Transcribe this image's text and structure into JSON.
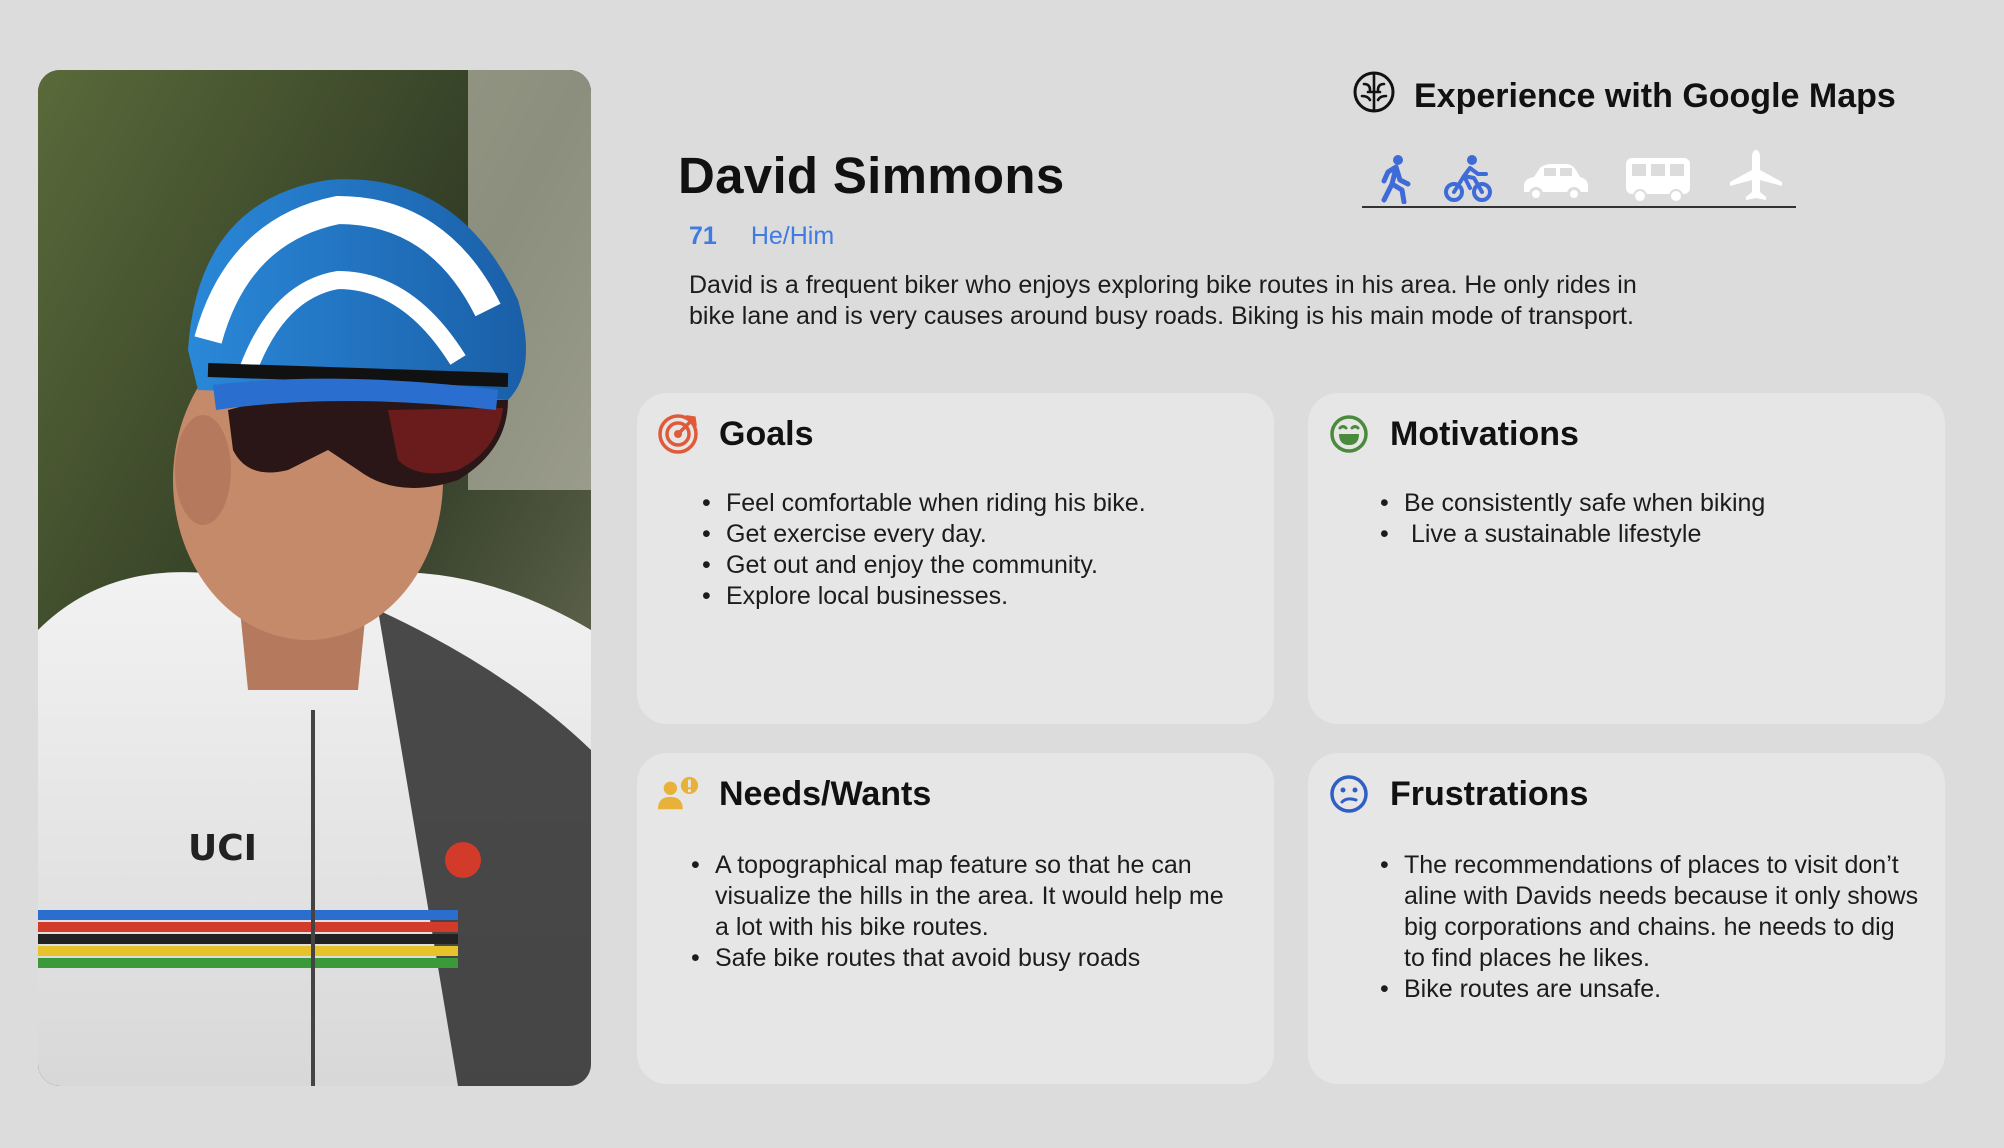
{
  "profile": {
    "name": "David Simmons",
    "age": "71",
    "pronouns": "He/Him",
    "bio": "David is a frequent biker who enjoys exploring bike routes in his area. He only rides in bike lane and is very causes around busy roads. Biking is his main mode of transport."
  },
  "experience": {
    "title": "Experience with Google Maps",
    "icon": "brain-icon",
    "modes": [
      {
        "name": "walk-icon",
        "color": "#3f6bd8"
      },
      {
        "name": "bike-icon",
        "color": "#3f6bd8"
      },
      {
        "name": "car-icon",
        "color": "#ffffff"
      },
      {
        "name": "bus-icon",
        "color": "#ffffff"
      },
      {
        "name": "plane-icon",
        "color": "#ffffff"
      }
    ]
  },
  "cards": {
    "goals": {
      "title": "Goals",
      "icon": "target-icon",
      "items": [
        "Feel comfortable when riding his bike.",
        "Get exercise every day.",
        "Get out and enjoy the community.",
        "Explore local businesses."
      ]
    },
    "motivations": {
      "title": "Motivations",
      "icon": "happy-face-icon",
      "items": [
        "Be consistently safe when biking",
        " Live a sustainable lifestyle"
      ]
    },
    "needs": {
      "title": "Needs/Wants",
      "icon": "person-idea-icon",
      "items": [
        "A topographical map feature so that he can visualize the hills in the area. It would help me a lot with his bike routes.",
        "Safe bike routes that avoid busy roads"
      ]
    },
    "frustrations": {
      "title": "Frustrations",
      "icon": "confused-face-icon",
      "items": [
        "The recommendations of places to visit don’t aline with Davids needs because it only shows big corporations and chains. he needs to dig to find places he likes.",
        "Bike routes are unsafe."
      ]
    }
  },
  "colors": {
    "accent_blue": "#3f7be2",
    "card_bg": "#e6e6e6",
    "page_bg": "#dcdcdc",
    "goals_icon": "#e05a3a",
    "motivations_icon": "#4a8a3c",
    "needs_icon": "#e8b23a",
    "frustrations_icon": "#2f5fc4"
  }
}
